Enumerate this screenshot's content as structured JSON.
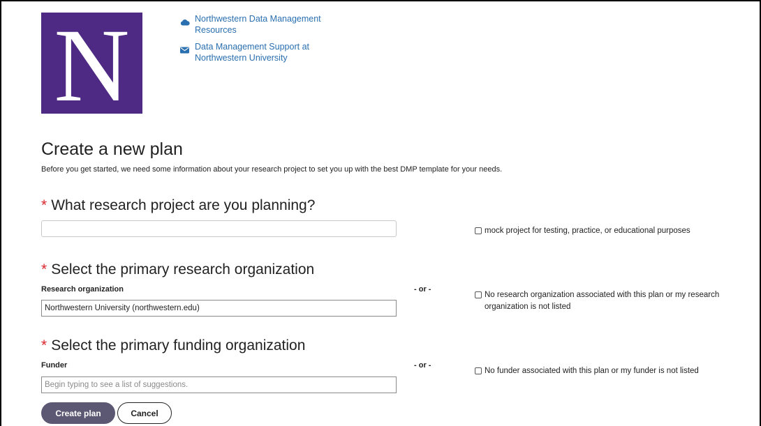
{
  "logo": {
    "letter": "N"
  },
  "resources": [
    {
      "label": "Northwestern Data Management Resources",
      "icon": "cloud-icon"
    },
    {
      "label": "Data Management Support at Northwestern University",
      "icon": "envelope-icon"
    }
  ],
  "page": {
    "title": "Create a new plan",
    "intro": "Before you get started, we need some information about your research project to set you up with the best DMP template for your needs."
  },
  "project": {
    "required_mark": "*",
    "question": "What research project are you planning?",
    "value": "",
    "mock_label": "mock project for testing, practice, or educational purposes"
  },
  "org": {
    "required_mark": "*",
    "question": "Select the primary research organization",
    "label": "Research organization",
    "value": "Northwestern University (northwestern.edu)",
    "or_text": "- or -",
    "none_label": "No research organization associated with this plan or my research organization is not listed"
  },
  "funder": {
    "required_mark": "*",
    "question": "Select the primary funding organization",
    "label": "Funder",
    "placeholder": "Begin typing to see a list of suggestions.",
    "or_text": "- or -",
    "none_label": "No funder associated with this plan or my funder is not listed"
  },
  "buttons": {
    "create": "Create plan",
    "cancel": "Cancel"
  },
  "colors": {
    "brand": "#4e2a84",
    "link": "#2a6fb0",
    "required": "#d9262c",
    "primary_button": "#5c5772"
  }
}
